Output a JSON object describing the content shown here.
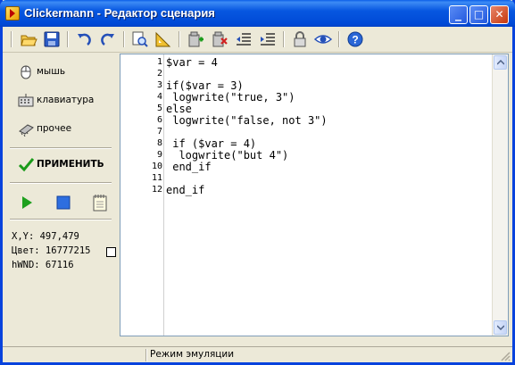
{
  "window": {
    "title": "Clickermann - Редактор сценария",
    "minimize": "_",
    "maximize": "□",
    "close": "✕"
  },
  "toolbar": {
    "icons": [
      "open-folder-icon",
      "save-icon",
      "undo-icon",
      "redo-icon",
      "find-icon",
      "ruler-icon",
      "insert-icon",
      "delete-icon",
      "outdent-icon",
      "indent-icon",
      "lock-icon",
      "eye-icon",
      "help-icon"
    ]
  },
  "left_panel": {
    "mouse_label": "мышь",
    "keyboard_label": "клавиатура",
    "other_label": "прочее",
    "apply_label": "ПРИМЕНИТЬ"
  },
  "info": {
    "xy": "X,Y:  497,479",
    "color": "Цвет: 16777215",
    "hwnd": "hWND: 67116"
  },
  "editor": {
    "lines": [
      {
        "n": "1",
        "text": "$var = 4"
      },
      {
        "n": "2",
        "text": ""
      },
      {
        "n": "3",
        "text": "if($var = 3)"
      },
      {
        "n": "4",
        "text": " logwrite(\"true, 3\")"
      },
      {
        "n": "5",
        "text": "else"
      },
      {
        "n": "6",
        "text": " logwrite(\"false, not 3\")"
      },
      {
        "n": "7",
        "text": ""
      },
      {
        "n": "8",
        "text": " if ($var = 4)"
      },
      {
        "n": "9",
        "text": "  logwrite(\"but 4\")"
      },
      {
        "n": "10",
        "text": " end_if"
      },
      {
        "n": "11",
        "text": ""
      },
      {
        "n": "12",
        "text": "end_if"
      }
    ]
  },
  "status": {
    "cell1": "",
    "cell2": "Режим эмуляции"
  }
}
